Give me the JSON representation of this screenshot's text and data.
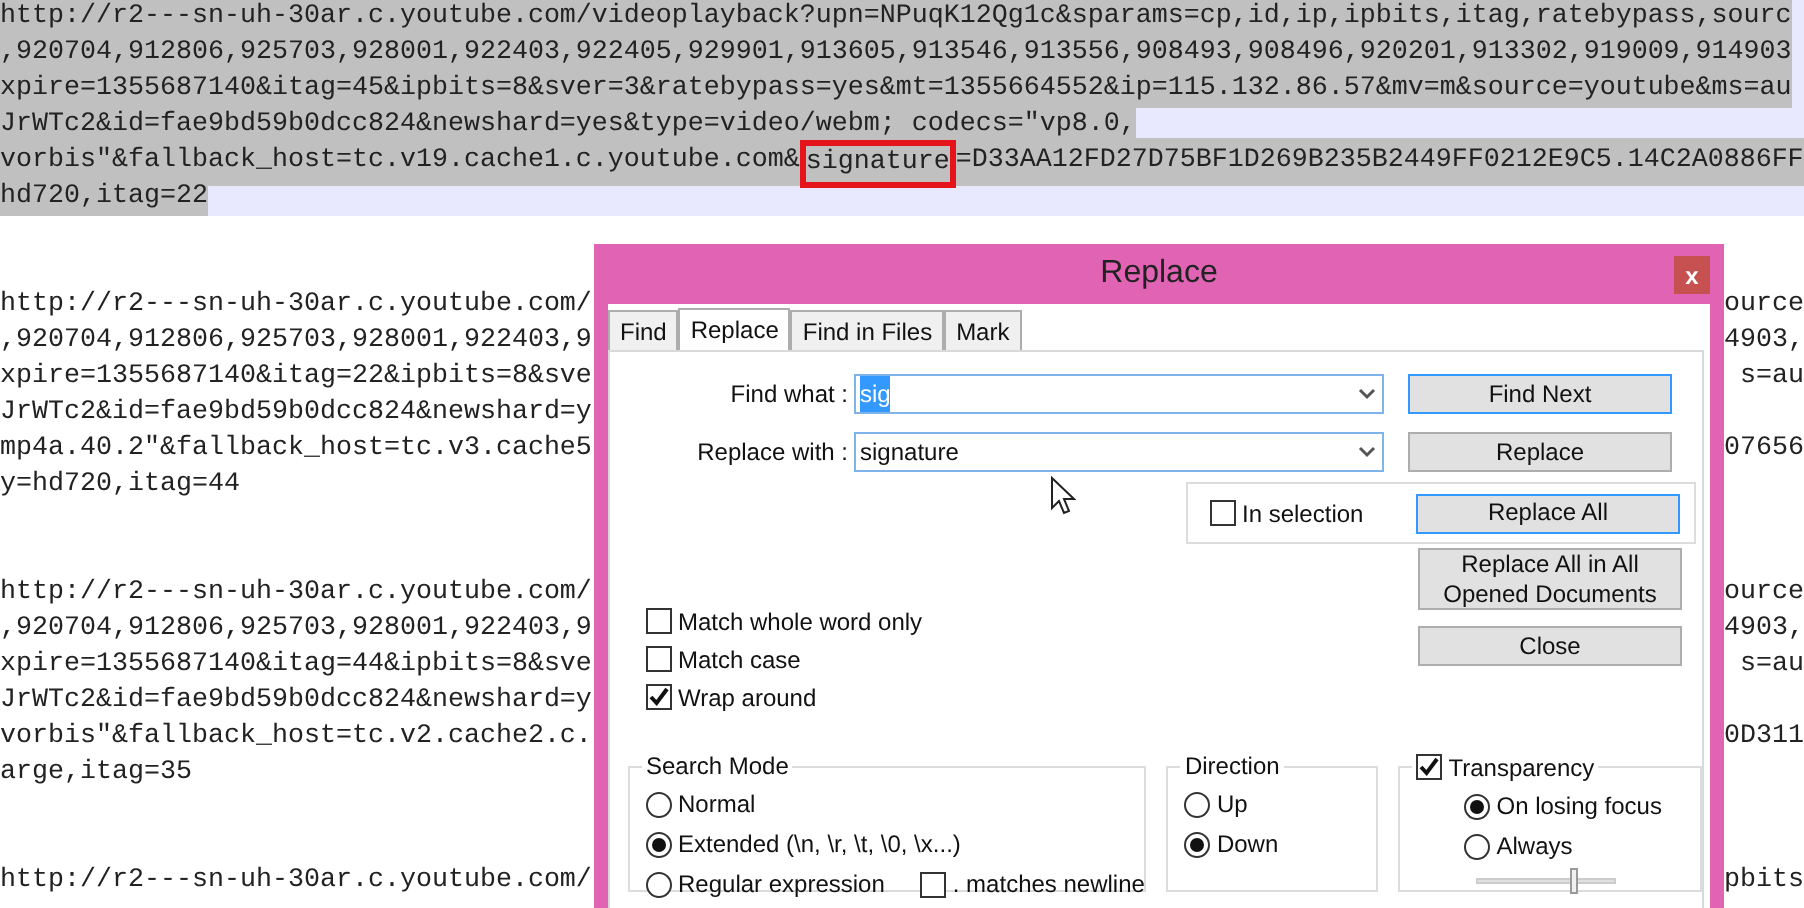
{
  "editor": {
    "lines": [
      {
        "kind": "text",
        "selected": true,
        "text": "http://r2---sn-uh-30ar.c.youtube.com/videoplayback?upn=NPuqK12Qg1c&sparams=cp,id,ip,ipbits,itag,ratebypass,sourc"
      },
      {
        "kind": "text",
        "selected": true,
        "text": ",920704,912806,925703,928001,922403,922405,929901,913605,913546,913556,908493,908496,920201,913302,919009,914903"
      },
      {
        "kind": "text",
        "selected": true,
        "text": "xpire=1355687140&itag=45&ipbits=8&sver=3&ratebypass=yes&mt=1355664552&ip=115.132.86.57&mv=m&source=youtube&ms=au"
      },
      {
        "kind": "text",
        "selected": true,
        "text": "JrWTc2&id=fae9bd59b0dcc824&newshard=yes&type=video/webm; codecs=\"vp8.0,"
      },
      {
        "kind": "text",
        "selected": true,
        "segments": [
          {
            "text": "vorbis\"&fallback_host=tc.v19.cache1.c.youtube.com&",
            "boxed": false
          },
          {
            "text": "signature",
            "boxed": true
          },
          {
            "text": "=D33AA12FD27D75BF1D269B235B2449FF0212E9C5.14C2A0886FF",
            "boxed": false
          }
        ]
      },
      {
        "kind": "text",
        "selected": true,
        "text": "hd720,itag=22"
      },
      {
        "kind": "blank"
      },
      {
        "kind": "blank"
      },
      {
        "kind": "text",
        "selected": false,
        "text": "http://r2---sn-uh-30ar.c.youtube.com/",
        "right_text": "ource"
      },
      {
        "kind": "text",
        "selected": false,
        "text": ",920704,912806,925703,928001,922403,9",
        "right_text": "4903,"
      },
      {
        "kind": "text",
        "selected": false,
        "text": "xpire=1355687140&itag=22&ipbits=8&sve",
        "right_text": "s=au"
      },
      {
        "kind": "text",
        "selected": false,
        "text": "JrWTc2&id=fae9bd59b0dcc824&newshard=y"
      },
      {
        "kind": "text",
        "selected": false,
        "text": "mp4a.40.2\"&fallback_host=tc.v3.cache5",
        "right_text": "07656"
      },
      {
        "kind": "text",
        "selected": false,
        "text": "y=hd720,itag=44"
      },
      {
        "kind": "blank"
      },
      {
        "kind": "blank"
      },
      {
        "kind": "text",
        "selected": false,
        "text": "http://r2---sn-uh-30ar.c.youtube.com/",
        "right_text": "ource"
      },
      {
        "kind": "text",
        "selected": false,
        "text": ",920704,912806,925703,928001,922403,9",
        "right_text": "4903,"
      },
      {
        "kind": "text",
        "selected": false,
        "text": "xpire=1355687140&itag=44&ipbits=8&sve",
        "right_text": "s=au"
      },
      {
        "kind": "text",
        "selected": false,
        "text": "JrWTc2&id=fae9bd59b0dcc824&newshard=y"
      },
      {
        "kind": "text",
        "selected": false,
        "text": "vorbis\"&fallback_host=tc.v2.cache2.c.",
        "right_text": "0D311"
      },
      {
        "kind": "text",
        "selected": false,
        "text": "arge,itag=35"
      },
      {
        "kind": "blank"
      },
      {
        "kind": "blank"
      },
      {
        "kind": "text",
        "selected": false,
        "text": "http://r2---sn-uh-30ar.c.youtube.com/",
        "right_text": "pbits"
      }
    ]
  },
  "dialog": {
    "title": "Replace",
    "close": "x",
    "tabs": [
      {
        "label": "Find",
        "selected": false
      },
      {
        "label": "Replace",
        "selected": true
      },
      {
        "label": "Find in Files",
        "selected": false
      },
      {
        "label": "Mark",
        "selected": false
      }
    ],
    "fields": [
      {
        "label": "Find what :",
        "value": "sig",
        "value_selected": true
      },
      {
        "label": "Replace with :",
        "value": "signature",
        "value_selected": false
      }
    ],
    "buttons": [
      {
        "label": "Find Next",
        "focused": true
      },
      {
        "label": "Replace",
        "focused": false
      },
      {
        "label": "Replace All",
        "focused": true
      },
      {
        "label": "Replace All in All Opened Documents",
        "focused": false
      },
      {
        "label": "Close",
        "focused": false
      }
    ],
    "in_selection": {
      "label": "In selection",
      "checked": false
    },
    "options": [
      {
        "label": "Match whole word only",
        "checked": false
      },
      {
        "label": "Match case",
        "checked": false
      },
      {
        "label": "Wrap around",
        "checked": true
      }
    ],
    "search_mode": {
      "title": "Search Mode",
      "options": [
        {
          "label": "Normal",
          "selected": false
        },
        {
          "label": "Extended (\\n, \\r, \\t, \\0, \\x...)",
          "selected": true
        },
        {
          "label": "Regular expression",
          "selected": false
        }
      ],
      "matches_newline": {
        "label": ". matches newline",
        "checked": false
      }
    },
    "direction": {
      "title": "Direction",
      "options": [
        {
          "label": "Up",
          "selected": false
        },
        {
          "label": "Down",
          "selected": true
        }
      ]
    },
    "transparency": {
      "label": "Transparency",
      "checked": true,
      "options": [
        {
          "label": "On losing focus",
          "selected": true
        },
        {
          "label": "Always",
          "selected": false
        }
      ],
      "level": 0.7
    }
  }
}
